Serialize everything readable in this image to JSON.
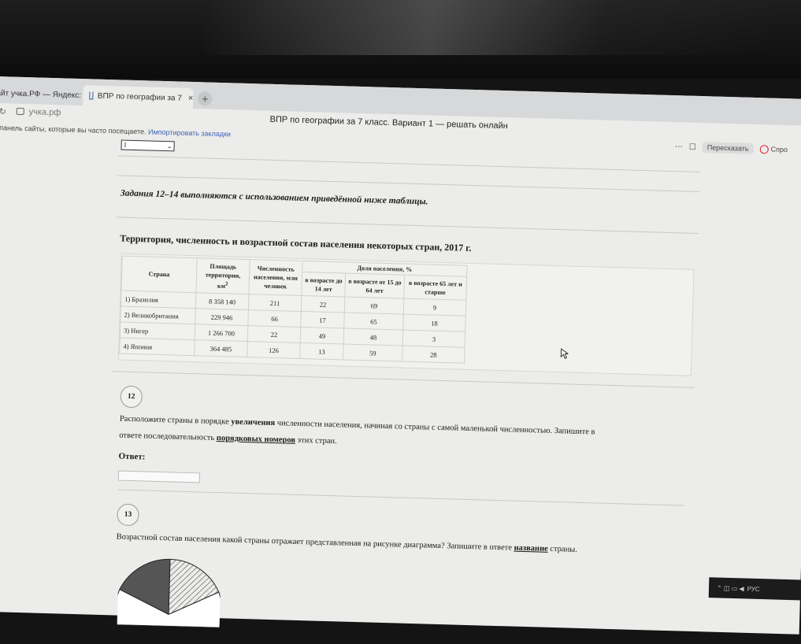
{
  "browser": {
    "tabs": [
      {
        "label": "айт учка.РФ — Яндекс: ›",
        "active": false
      },
      {
        "label": "ВПР по географии за 7",
        "active": true
      }
    ],
    "tab_close": "×",
    "new_tab": "+",
    "url": "учка.рф",
    "page_title": "ВПР по географии за 7 класс. Вариант 1 — решать онлайн",
    "bookmarks_hint": "у панель сайты, которые вы часто посещаете.",
    "bookmarks_import": "Импортировать закладки",
    "retell_label": "Пересказать",
    "ask_label": "Спро"
  },
  "page": {
    "select_value": "1",
    "intro": "Задания 12–14 выполняются с использованием приведённой ниже таблицы.",
    "table_title": "Территория, численность и возрастной состав населения некоторых стран, 2017 г.",
    "table": {
      "h_country": "Страна",
      "h_area": "Площадь территории,",
      "h_area_unit": "км",
      "h_area_sup": "2",
      "h_pop": "Численность населения, млн человек",
      "h_share": "Доля населения, %",
      "h_age1": "в возрасте до 14 лет",
      "h_age2": "в возрасте от 15 до 64 лет",
      "h_age3": "в возрасте 65 лет и старше",
      "rows": [
        {
          "country": "1) Бразилия",
          "area": "8 358 140",
          "pop": "211",
          "a1": "22",
          "a2": "69",
          "a3": "9"
        },
        {
          "country": "2) Великобритания",
          "area": "229 946",
          "pop": "66",
          "a1": "17",
          "a2": "65",
          "a3": "18"
        },
        {
          "country": "3) Нигер",
          "area": "1 266 700",
          "pop": "22",
          "a1": "49",
          "a2": "48",
          "a3": "3"
        },
        {
          "country": "4) Япония",
          "area": "364 485",
          "pop": "126",
          "a1": "13",
          "a2": "59",
          "a3": "28"
        }
      ]
    },
    "q12": {
      "number": "12",
      "t1": "Расположите страны в порядке ",
      "t1b": "увеличения",
      "t2": " численности населения, начиная со страны с самой маленькой численностью. Запишите в",
      "t3": "ответе последовательность ",
      "t3b": "порядковых номеров",
      "t4": " этих стран.",
      "answer_label": "Ответ:"
    },
    "q13": {
      "number": "13",
      "t1": "Возрастной состав населения какой страны отражает представленная на рисунке диаграмма? Запишите в ответе ",
      "t1b": "название",
      "t2": " страны."
    }
  },
  "taskbar": {
    "lang": "РУС"
  }
}
